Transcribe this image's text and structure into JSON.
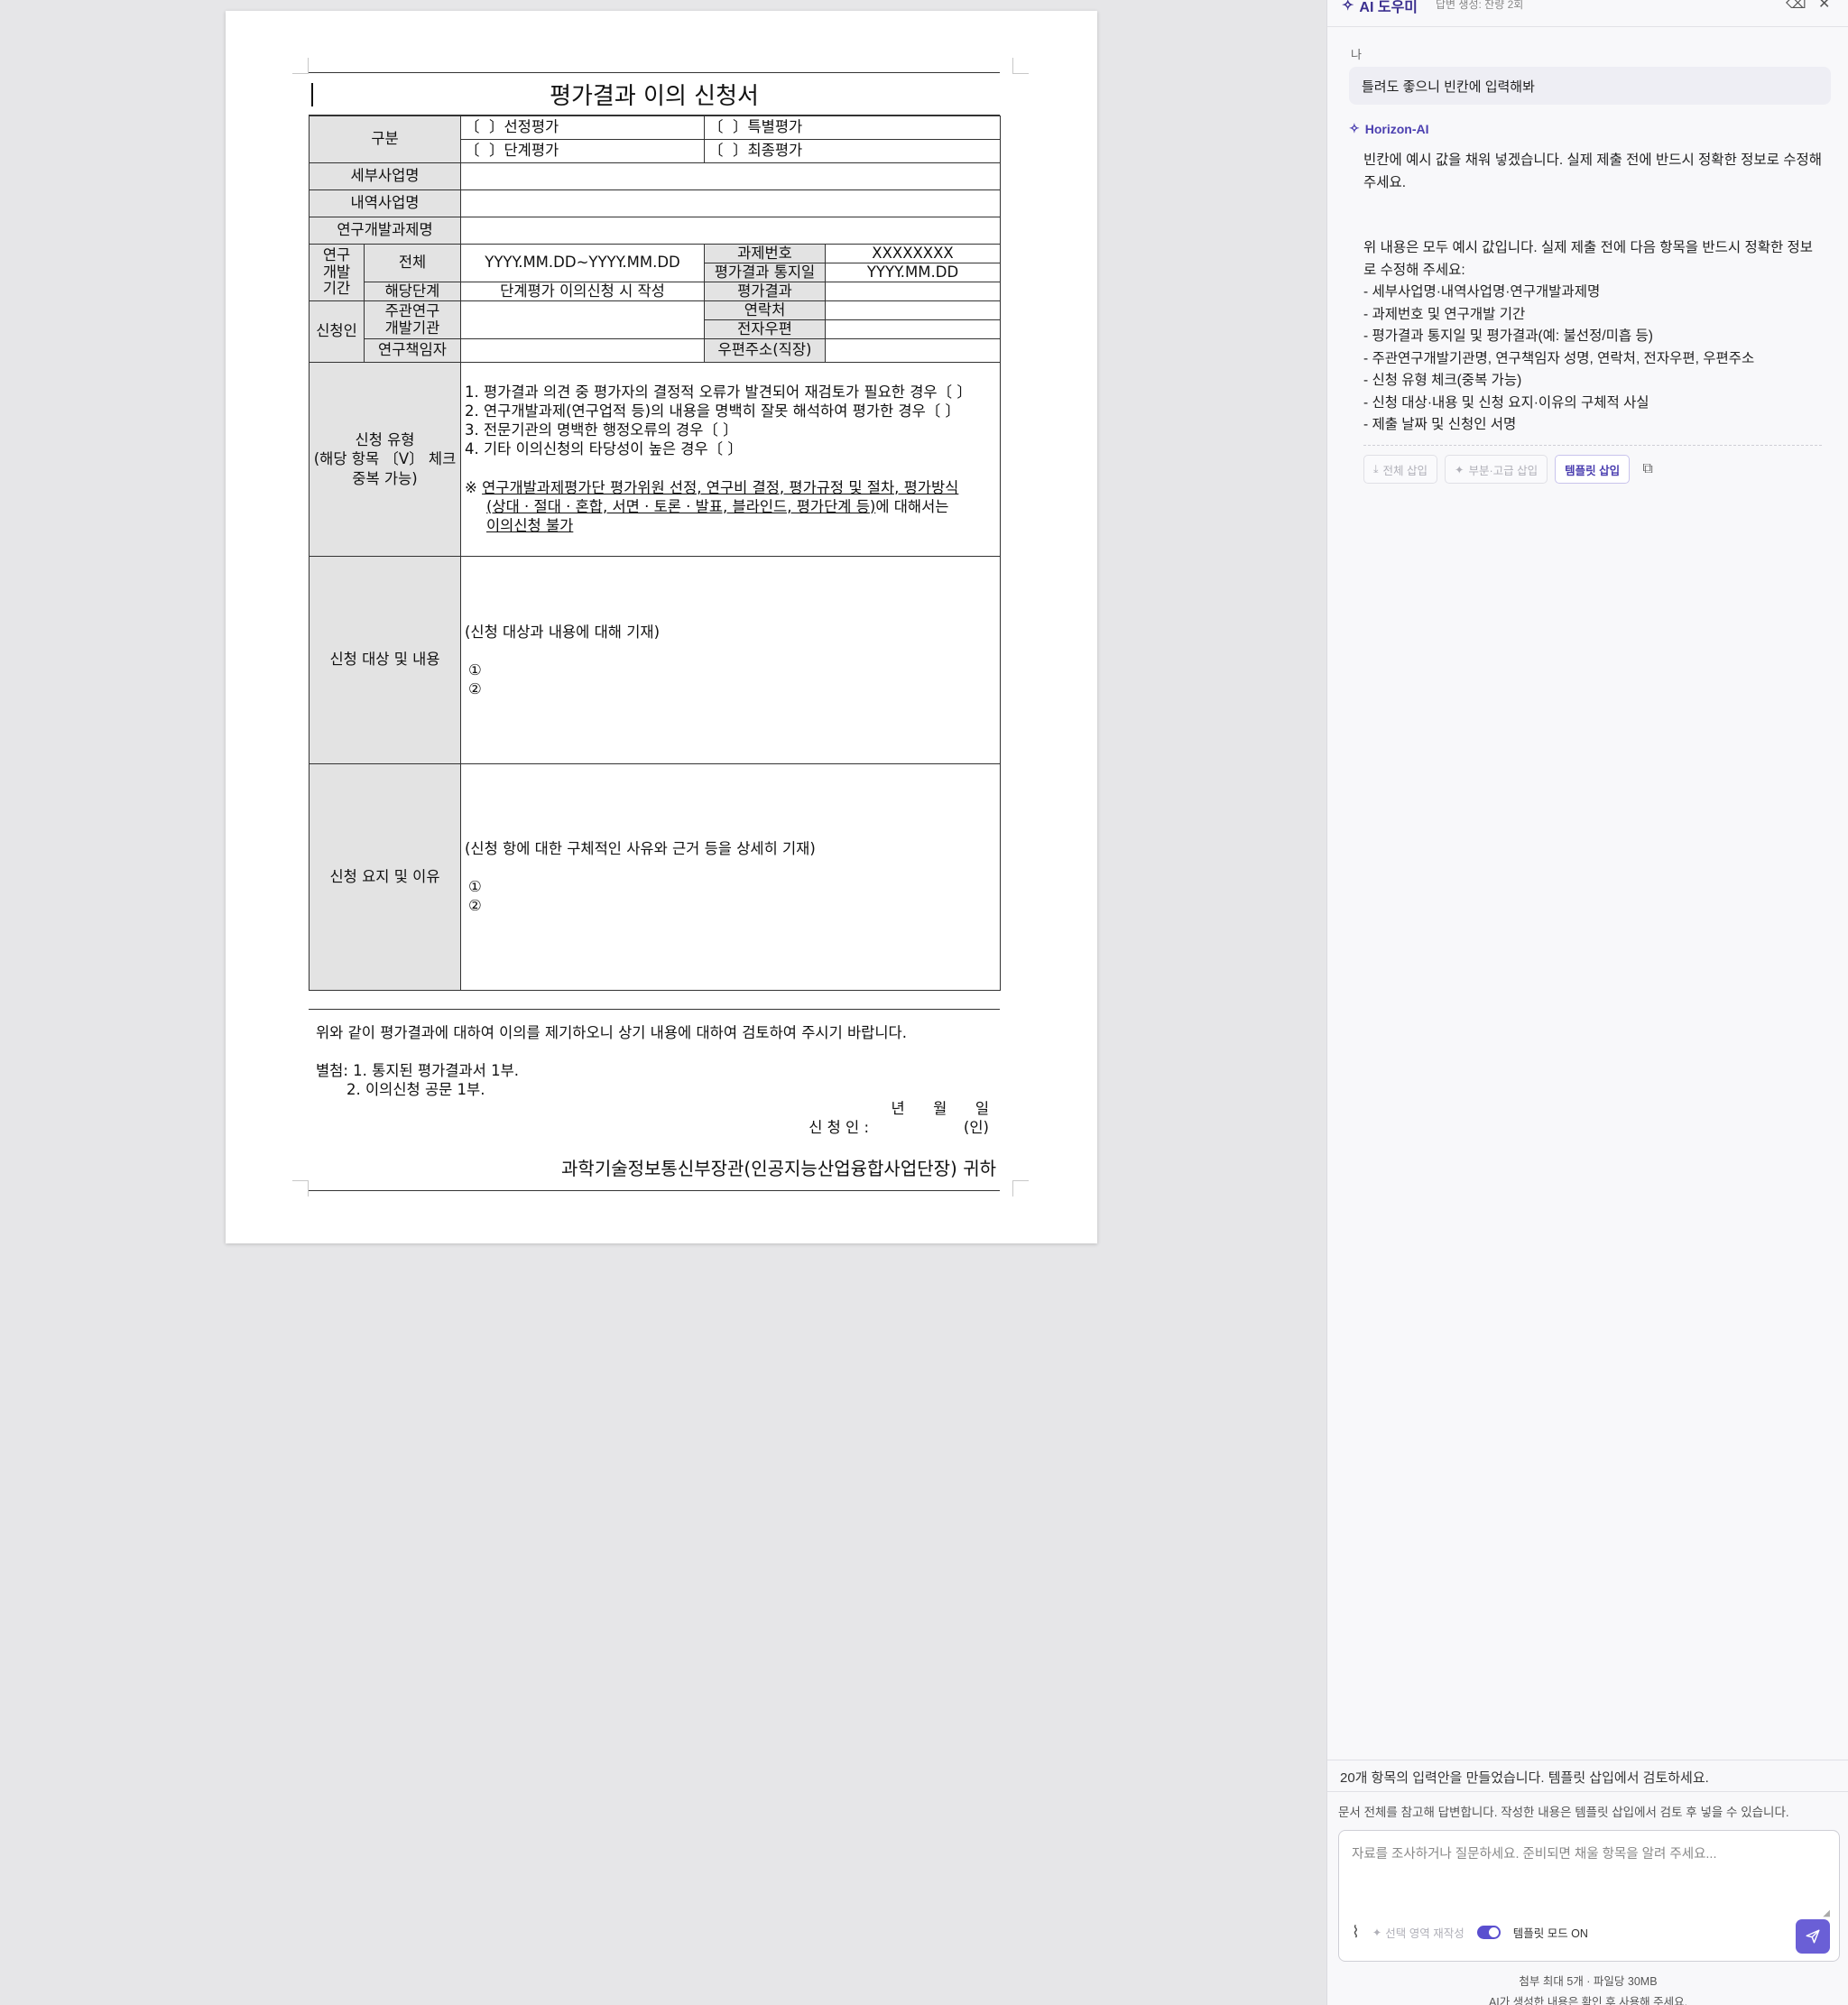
{
  "document": {
    "title": "평가결과 이의 신청서",
    "rows": {
      "gubun_label": "구분",
      "opt_selection": "〔  〕선정평가",
      "opt_special": "〔  〕특별평가",
      "opt_stage": "〔  〕단계평가",
      "opt_final": "〔  〕최종평가",
      "detail_biz_label": "세부사업명",
      "item_biz_label": "내역사업명",
      "rnd_task_label": "연구개발과제명",
      "period_label": "연구\n개발\n기간",
      "total_label": "전체",
      "total_value": "YYYY.MM.DD~YYYY.MM.DD",
      "task_no_label": "과제번호",
      "task_no_value": "XXXXXXXX",
      "notice_date_label": "평가결과 통지일",
      "notice_date_value": "YYYY.MM.DD",
      "stage_label": "해당단계",
      "stage_value": "단계평가 이의신청 시 작성",
      "result_label": "평가결과",
      "applicant_label": "신청인",
      "lead_org_label": "주관연구\n개발기관",
      "contact_label": "연락처",
      "email_label": "전자우편",
      "pi_label": "연구책임자",
      "address_label": "우편주소(직장)",
      "type_label": "신청 유형\n(해당 항목 〔V〕 체크\n중복 가능)",
      "type_items": [
        "1. 평가결과 의견 중 평가자의 결정적 오류가 발견되어 재검토가 필요한 경우〔 〕",
        "2. 연구개발과제(연구업적 등)의 내용을 명백히 잘못 해석하여 평가한 경우〔 〕",
        "3. 전문기관의 명백한 행정오류의 경우〔 〕",
        "4. 기타 이의신청의 타당성이 높은 경우〔 〕"
      ],
      "type_note_mark": "※ ",
      "type_note_u1": "연구개발과제평가단 평가위원 선정, 연구비 결정, 평가규정 및 절차, 평가방식",
      "type_note_u2": "(상대 · 절대 · 혼합, 서면 · 토론 · 발표, 블라인드, 평가단계 등)",
      "type_note_tail": "에 대해서는",
      "type_note_u3": "이의신청 불가",
      "target_label": "신청 대상 및 내용",
      "target_hint": "(신청 대상과 내용에 대해 기재)",
      "reason_label": "신청 요지 및 이유",
      "reason_hint": "(신청 항에 대한 구체적인 사유와 근거 등을 상세히 기재)",
      "circle1": "①",
      "circle2": "②"
    },
    "footer": {
      "statement": "위와 같이 평가결과에 대하여 이의를 제기하오니 상기 내용에 대하여 검토하여 주시기 바랍니다.",
      "attach1": "별첨: 1. 통지된 평가결과서 1부.",
      "attach2": "2. 이의신청 공문 1부.",
      "date_line": "년      월      일",
      "sign_line": "신 청 인 :                    (인)",
      "recipient": "과학기술정보통신부장관(인공지능산업융합사업단장) 귀하"
    }
  },
  "panel": {
    "title": "AI 도우미",
    "subtitle": "답변 생성: 잔량 2회",
    "user_label": "나",
    "user_message": "틀려도 좋으니 빈칸에 입력해봐",
    "ai_name": "Horizon-AI",
    "ai_intro": "빈칸에 예시 값을 채워 넣겠습니다. 실제 제출 전에 반드시 정확한 정보로 수정해 주세요.",
    "ai_note": "위 내용은 모두 예시 값입니다. 실제 제출 전에 다음 항목을 반드시 정확한 정보로 수정해 주세요:",
    "ai_list": [
      "- 세부사업명·내역사업명·연구개발과제명",
      "- 과제번호 및 연구개발 기간",
      "- 평가결과 통지일 및 평가결과(예: 불선정/미흡 등)",
      "- 주관연구개발기관명, 연구책임자 성명, 연락처, 전자우편, 우편주소",
      "- 신청 유형 체크(중복 가능)",
      "- 신청 대상·내용 및 신청 요지·이유의 구체적 사실",
      "- 제출 날짜 및 신청인 서명"
    ],
    "actions": {
      "insert_all": "전체 삽입",
      "insert_partial": "부분·고급 삽입",
      "insert_template": "템플릿 삽입"
    },
    "status": "20개 항목의 입력안을 만들었습니다. 템플릿 삽입에서 검토하세요.",
    "info": "문서 전체를 참고해 답변합니다. 작성한 내용은 템플릿 삽입에서 검토 후 넣을 수 있습니다.",
    "input_placeholder": "자료를 조사하거나 질문하세요. 준비되면 채울 항목을 알려 주세요...",
    "rewrite_selection": "선택 영역 재작성",
    "template_mode": "템플릿 모드 ON",
    "footer_attach": "첨부 최대 5개 · 파일당 30MB",
    "footer_notice": "AI가 생성한 내용은 확인 후 사용해 주세요."
  }
}
